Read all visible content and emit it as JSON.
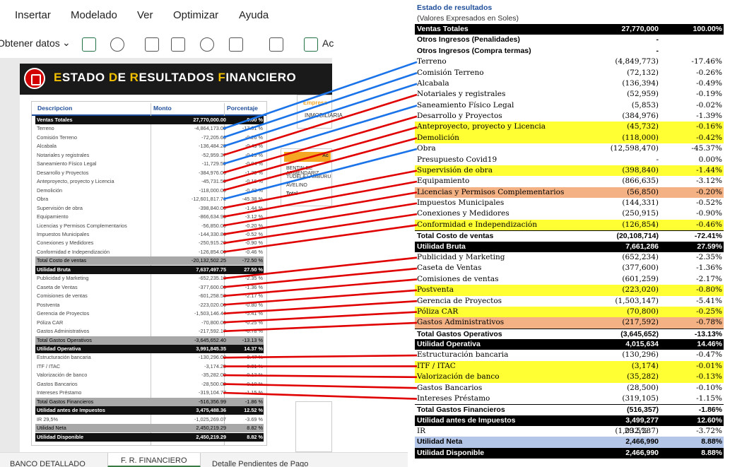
{
  "menu": [
    "Insertar",
    "Modelado",
    "Ver",
    "Optimizar",
    "Ayuda"
  ],
  "ribbon": {
    "get_data": "Obtener datos",
    "cut_label": "Ac"
  },
  "report": {
    "title_parts": [
      [
        "E",
        "y"
      ],
      [
        "STADO ",
        "w"
      ],
      [
        "D",
        "y"
      ],
      [
        "E ",
        "w"
      ],
      [
        "R",
        "y"
      ],
      [
        "ESULTADOS ",
        "w"
      ],
      [
        "F",
        "y"
      ],
      [
        "INANCIERO",
        "w"
      ]
    ],
    "columns": [
      "Descripcion",
      "Monto",
      "Porcentaje"
    ],
    "rows": [
      {
        "d": "Ventas Totales",
        "m": "27,770,000.00",
        "p": "0.00 %",
        "s": "b"
      },
      {
        "d": "Terreno",
        "m": "-4,864,173.00",
        "p": "-17.51 %",
        "s": "n"
      },
      {
        "d": "Comisión Terreno",
        "m": "-72,205.66",
        "p": "-0.26 %",
        "s": "n"
      },
      {
        "d": "Alcabala",
        "m": "-136,484.25",
        "p": "-0.49 %",
        "s": "n"
      },
      {
        "d": "Notariales y registrales",
        "m": "-52,959.37",
        "p": "-0.19 %",
        "s": "n"
      },
      {
        "d": "Saneamiento Físico Legal",
        "m": "-11,729.59",
        "p": "-0.04 %",
        "s": "n"
      },
      {
        "d": "Desarrollo y Proyectos",
        "m": "-384,976.06",
        "p": "-1.39 %",
        "s": "n"
      },
      {
        "d": "Anteproyecto, proyecto y Licencia",
        "m": "-45,731.50",
        "p": "-0.16 %",
        "s": "n"
      },
      {
        "d": "Demolición",
        "m": "-118,000.00",
        "p": "-0.42 %",
        "s": "n"
      },
      {
        "d": "Obra",
        "m": "-12,601,817.71",
        "p": "-45.38 %",
        "s": "n"
      },
      {
        "d": "Supervisión de obra",
        "m": "-398,840.00",
        "p": "-1.44 %",
        "s": "n"
      },
      {
        "d": "Equipamiento",
        "m": "-866,634.95",
        "p": "-3.12 %",
        "s": "n"
      },
      {
        "d": "Licencias y Permisos Complementarios",
        "m": "-56,850.00",
        "p": "-0.20 %",
        "s": "n"
      },
      {
        "d": "Impuestos Municipales",
        "m": "-144,330.86",
        "p": "-0.52 %",
        "s": "n"
      },
      {
        "d": "Conexiones y Medidores",
        "m": "-250,915.20",
        "p": "-0.90 %",
        "s": "n"
      },
      {
        "d": "Conformidad e Independización",
        "m": "-126,854.00",
        "p": "-0.46 %",
        "s": "n"
      },
      {
        "d": "Total Costo de ventas",
        "m": "-20,132,502.25",
        "p": "-72.50 %",
        "s": "g"
      },
      {
        "d": "Utilidad Bruta",
        "m": "7,637,497.75",
        "p": "27.50 %",
        "s": "b"
      },
      {
        "d": "Publicidad y Marketing",
        "m": "-652,235.18",
        "p": "-2.35 %",
        "s": "n"
      },
      {
        "d": "Caseta de Ventas",
        "m": "-377,600.00",
        "p": "-1.36 %",
        "s": "n"
      },
      {
        "d": "Comisiones de ventas",
        "m": "-601,258.53",
        "p": "-2.17 %",
        "s": "n"
      },
      {
        "d": "Postventa",
        "m": "-223,020.00",
        "p": "-0.80 %",
        "s": "n"
      },
      {
        "d": "Gerencia de Proyectos",
        "m": "-1,503,146.44",
        "p": "-5.41 %",
        "s": "n"
      },
      {
        "d": "Póliza CAR",
        "m": "-70,800.00",
        "p": "-0.25 %",
        "s": "n"
      },
      {
        "d": "Gastos Administrativos",
        "m": "-217,592.17",
        "p": "-0.78 %",
        "s": "n"
      },
      {
        "d": "Total Gastos Operativos",
        "m": "-3,645,652.40",
        "p": "-13.13 %",
        "s": "g"
      },
      {
        "d": "Utilidad Operativa",
        "m": "3,991,845.35",
        "p": "14.37 %",
        "s": "b"
      },
      {
        "d": "Estructuración bancaria",
        "m": "-130,296.00",
        "p": "-0.47 %",
        "s": "n"
      },
      {
        "d": "ITF / ITAC",
        "m": "-3,174.20",
        "p": "-0.01 %",
        "s": "n"
      },
      {
        "d": "Valorización de banco",
        "m": "-35,282.00",
        "p": "-0.13 %",
        "s": "n"
      },
      {
        "d": "Gastos Bancarios",
        "m": "-28,500.02",
        "p": "-0.10 %",
        "s": "n"
      },
      {
        "d": "Intereses Préstamo",
        "m": "-319,104.77",
        "p": "-1.15 %",
        "s": "n"
      },
      {
        "d": "Total Gastos Financieros",
        "m": "-516,356.99",
        "p": "-1.86 %",
        "s": "g"
      },
      {
        "d": "Utilidad antes de Impuestos",
        "m": "3,475,488.36",
        "p": "12.52 %",
        "s": "b"
      },
      {
        "d": "IR 29,5%",
        "m": "-1,025,269.07",
        "p": "-3.69 %",
        "s": "n"
      },
      {
        "d": "Utilidad Neta",
        "m": "2,450,219.29",
        "p": "8.82 %",
        "s": "g"
      },
      {
        "d": "Utilidad Disponible",
        "m": "2,450,219.29",
        "p": "8.82 %",
        "s": "b"
      }
    ],
    "empresa_card": {
      "label": "Empresa",
      "value": "INMOBILIARIA"
    },
    "filter_card": {
      "title": "Ac",
      "items": [
        "BENTIN DE ARMENDARIZ",
        "TUDELA LAMBURU",
        "AVELINO"
      ],
      "total": "Total"
    }
  },
  "excel": {
    "title": "Estado de resultados",
    "subtitle": "(Valores Expresados en Soles)",
    "rows": [
      {
        "d": "Ventas Totales",
        "m": "27,770,000",
        "p": "100.00%",
        "s": "bk"
      },
      {
        "d": "Otros Ingresos (Penalidades)",
        "m": "-",
        "p": "",
        "s": "b"
      },
      {
        "d": "Otros Ingresos (Compra termas)",
        "m": "-",
        "p": "",
        "s": "b"
      },
      {
        "d": "Terreno",
        "m": "(4,849,773)",
        "p": "-17.46%",
        "s": ""
      },
      {
        "d": "Comisión Terreno",
        "m": "(72,132)",
        "p": "-0.26%",
        "s": ""
      },
      {
        "d": "Alcabala",
        "m": "(136,394)",
        "p": "-0.49%",
        "s": ""
      },
      {
        "d": "Notariales y registrales",
        "m": "(52,959)",
        "p": "-0.19%",
        "s": ""
      },
      {
        "d": "Saneamiento Físico Legal",
        "m": "(5,853)",
        "p": "-0.02%",
        "s": ""
      },
      {
        "d": "Desarrollo y Proyectos",
        "m": "(384,976)",
        "p": "-1.39%",
        "s": ""
      },
      {
        "d": "Anteproyecto, proyecto y Licencia",
        "m": "(45,732)",
        "p": "-0.16%",
        "s": "yl"
      },
      {
        "d": "Demolición",
        "m": "(118,000)",
        "p": "-0.42%",
        "s": "yl"
      },
      {
        "d": "Obra",
        "m": "(12,598,470)",
        "p": "-45.37%",
        "s": ""
      },
      {
        "d": "Presupuesto Covid19",
        "m": "-",
        "p": "0.00%",
        "s": ""
      },
      {
        "d": "Supervisión de obra",
        "m": "(398,840)",
        "p": "-1.44%",
        "s": "yl"
      },
      {
        "d": "Equipamiento",
        "m": "(866,635)",
        "p": "-3.12%",
        "s": ""
      },
      {
        "d": "Licencias y Permisos Complementarios",
        "m": "(56,850)",
        "p": "-0.20%",
        "s": "or"
      },
      {
        "d": "Impuestos Municipales",
        "m": "(144,331)",
        "p": "-0.52%",
        "s": ""
      },
      {
        "d": "Conexiones y Medidores",
        "m": "(250,915)",
        "p": "-0.90%",
        "s": ""
      },
      {
        "d": "Conformidad e Independización",
        "m": "(126,854)",
        "p": "-0.46%",
        "s": "yl"
      },
      {
        "d": "Total Costo de ventas",
        "m": "(20,108,714)",
        "p": "-72.41%",
        "s": "b tl"
      },
      {
        "d": "Utilidad Bruta",
        "m": "7,661,286",
        "p": "27.59%",
        "s": "bk"
      },
      {
        "d": "Publicidad y Marketing",
        "m": "(652,234)",
        "p": "-2.35%",
        "s": ""
      },
      {
        "d": "Caseta de Ventas",
        "m": "(377,600)",
        "p": "-1.36%",
        "s": ""
      },
      {
        "d": "Comisiones de ventas",
        "m": "(601,259)",
        "p": "-2.17%",
        "s": ""
      },
      {
        "d": "Postventa",
        "m": "(223,020)",
        "p": "-0.80%",
        "s": "yl"
      },
      {
        "d": "Gerencia de Proyectos",
        "m": "(1,503,147)",
        "p": "-5.41%",
        "s": ""
      },
      {
        "d": "Póliza CAR",
        "m": "(70,800)",
        "p": "-0.25%",
        "s": "yl"
      },
      {
        "d": "Gastos Administrativos",
        "m": "(217,592)",
        "p": "-0.78%",
        "s": "or"
      },
      {
        "d": "Total Gastos Operativos",
        "m": "(3,645,652)",
        "p": "-13.13%",
        "s": "b tl"
      },
      {
        "d": "Utilidad Operativa",
        "m": "4,015,634",
        "p": "14.46%",
        "s": "bk"
      },
      {
        "d": "Estructuración bancaria",
        "m": "(130,296)",
        "p": "-0.47%",
        "s": ""
      },
      {
        "d": "ITF / ITAC",
        "m": "(3,174)",
        "p": "-0.01%",
        "s": "yl"
      },
      {
        "d": "Valorización de banco",
        "m": "(35,282)",
        "p": "-0.13%",
        "s": "yl"
      },
      {
        "d": "Gastos Bancarios",
        "m": "(28,500)",
        "p": "-0.10%",
        "s": ""
      },
      {
        "d": "Intereses Préstamo",
        "m": "(319,105)",
        "p": "-1.15%",
        "s": ""
      },
      {
        "d": "Total Gastos Financieros",
        "m": "(516,357)",
        "p": "-1.86%",
        "s": "b tl"
      },
      {
        "d": "Utilidad antes de Impuestos",
        "m": "3,499,277",
        "p": "12.60%",
        "s": "bk"
      },
      {
        "d": "IR",
        "x": "29.5%",
        "m": "(1,032,287)",
        "p": "-3.72%",
        "s": ""
      },
      {
        "d": "Utilidad Neta",
        "m": "2,466,990",
        "p": "8.88%",
        "s": "bl"
      },
      {
        "d": "Utilidad Disponible",
        "m": "2,466,990",
        "p": "8.88%",
        "s": "bk"
      }
    ]
  },
  "connectors": [
    {
      "from": 1,
      "to": 3,
      "color": "#1a73e8"
    },
    {
      "from": 2,
      "to": 4,
      "color": "#1a73e8"
    },
    {
      "from": 3,
      "to": 5,
      "color": "#1a73e8"
    },
    {
      "from": 4,
      "to": 6,
      "color": "#e00000"
    },
    {
      "from": 5,
      "to": 7,
      "color": "#1a73e8"
    },
    {
      "from": 6,
      "to": 8,
      "color": "#e00000"
    },
    {
      "from": 7,
      "to": 9,
      "color": "#e00000"
    },
    {
      "from": 8,
      "to": 10,
      "color": "#e00000"
    },
    {
      "from": 9,
      "to": 11,
      "color": "#1a73e8"
    },
    {
      "from": 10,
      "to": 13,
      "color": "#e00000"
    },
    {
      "from": 11,
      "to": 14,
      "color": "#e00000"
    },
    {
      "from": 12,
      "to": 15,
      "color": "#e00000"
    },
    {
      "from": 13,
      "to": 16,
      "color": "#e00000"
    },
    {
      "from": 14,
      "to": 17,
      "color": "#e00000"
    },
    {
      "from": 15,
      "to": 18,
      "color": "#e00000"
    },
    {
      "from": 18,
      "to": 21,
      "color": "#e00000"
    },
    {
      "from": 19,
      "to": 22,
      "color": "#e00000"
    },
    {
      "from": 20,
      "to": 23,
      "color": "#e00000"
    },
    {
      "from": 21,
      "to": 24,
      "color": "#e00000"
    },
    {
      "from": 22,
      "to": 25,
      "color": "#e00000"
    },
    {
      "from": 23,
      "to": 26,
      "color": "#e00000"
    },
    {
      "from": 24,
      "to": 27,
      "color": "#e00000"
    },
    {
      "from": 27,
      "to": 30,
      "color": "#e00000"
    },
    {
      "from": 28,
      "to": 31,
      "color": "#e00000"
    },
    {
      "from": 29,
      "to": 32,
      "color": "#e00000"
    },
    {
      "from": 30,
      "to": 33,
      "color": "#e00000"
    },
    {
      "from": 31,
      "to": 34,
      "color": "#e00000"
    }
  ],
  "sheet_tabs": [
    "BANCO DETALLADO",
    "F. R. FINANCIERO",
    "Detalle Pendientes de Pago"
  ],
  "colors": {
    "blue_line": "#1a73e8",
    "red_line": "#e00000",
    "highlight_yellow": "#ffff33",
    "highlight_orange": "#f4b183",
    "net_blue": "#b4c6e7"
  }
}
